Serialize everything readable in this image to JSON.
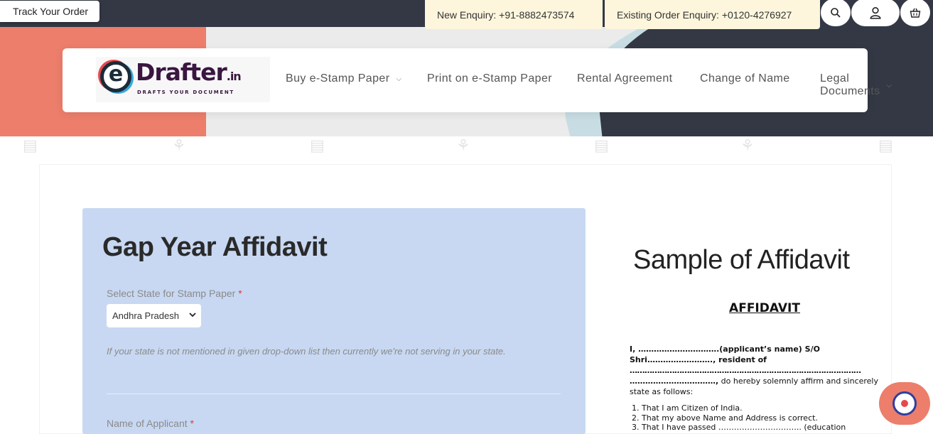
{
  "topbar": {
    "track_order": "Track Your Order",
    "new_enquiry": "New Enquiry: +91-8882473574",
    "existing_enquiry": "Existing Order Enquiry: +0120-4276927",
    "icons": [
      "search-icon",
      "user-icon",
      "basket-icon"
    ]
  },
  "logo": {
    "letter": "e",
    "name": "Drafter",
    "suffix": ".in",
    "tagline": "DRAFTS YOUR DOCUMENT"
  },
  "nav": {
    "items": [
      {
        "label": "Buy e-Stamp Paper",
        "dropdown": true
      },
      {
        "label": "Print on e-Stamp Paper",
        "dropdown": false
      },
      {
        "label": "Rental Agreement",
        "dropdown": false
      },
      {
        "label": "Change of Name",
        "dropdown": false
      },
      {
        "label": "Legal Documents",
        "dropdown": true
      }
    ]
  },
  "form": {
    "title": "Gap Year Affidavit",
    "state_label": "Select State for Stamp Paper",
    "required_mark": "*",
    "state_value": "Andhra Pradesh",
    "hint": "If your state is not mentioned in given drop-down list then currently we're not serving in your state.",
    "applicant_label": "Name of Applicant"
  },
  "sample": {
    "title": "Sample of Affidavit",
    "heading": "AFFIDAVIT",
    "line1": "I, ………………………….(applicant’s name) S/O",
    "line2": "Shri……………………., resident of",
    "line3": "…………………………………………………………………………………",
    "line4_bold": "……………………………,",
    "line4_rest": " do hereby solemnly affirm and sincerely",
    "line5": "state as follows:",
    "list": [
      "That I am Citizen of India.",
      "That my above Name and Address is correct.",
      "That I have passed ………………………….. (education"
    ]
  },
  "colors": {
    "coral": "#ec7e6b",
    "dark": "#333844",
    "panel": "#c8d8f2",
    "enquiry_bg": "#fdf6dd"
  }
}
